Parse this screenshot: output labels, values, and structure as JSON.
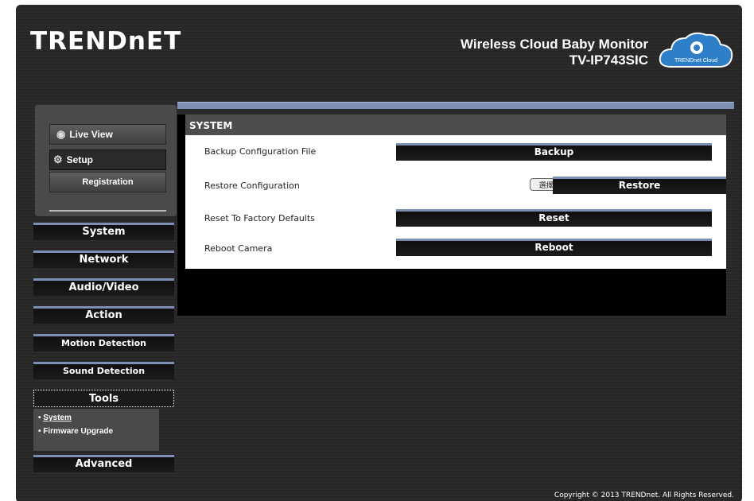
{
  "header": {
    "brand": "TRENDnET",
    "product_name": "Wireless Cloud Baby Monitor",
    "model": "TV-IP743SIC",
    "cloud_label": "TRENDnet Cloud"
  },
  "left_nav": {
    "live_view": "Live View",
    "setup": "Setup",
    "registration": "Registration",
    "menu": {
      "system": "System",
      "network": "Network",
      "audio_video": "Audio/Video",
      "action": "Action",
      "motion": "Motion Detection",
      "sound": "Sound Detection",
      "tools": "Tools",
      "advanced": "Advanced"
    },
    "tools_sub": {
      "system": "System",
      "firmware": "Firmware Upgrade"
    }
  },
  "main": {
    "section_title": "SYSTEM",
    "rows": {
      "backup_label": "Backup Configuration File",
      "backup_button": "Backup",
      "restore_label": "Restore Configuration",
      "browse_button": "選擇…",
      "restore_button": "Restore",
      "reset_label": "Reset To Factory Defaults",
      "reset_button": "Reset",
      "reboot_label": "Reboot Camera",
      "reboot_button": "Reboot"
    }
  },
  "footer": {
    "copyright": "Copyright © 2013 TRENDnet. All Rights Reserved."
  },
  "colors": {
    "accent_blue": "#7d8fb5",
    "frame_dark": "#2b2b2b",
    "panel_gray": "#4a4a4a"
  }
}
